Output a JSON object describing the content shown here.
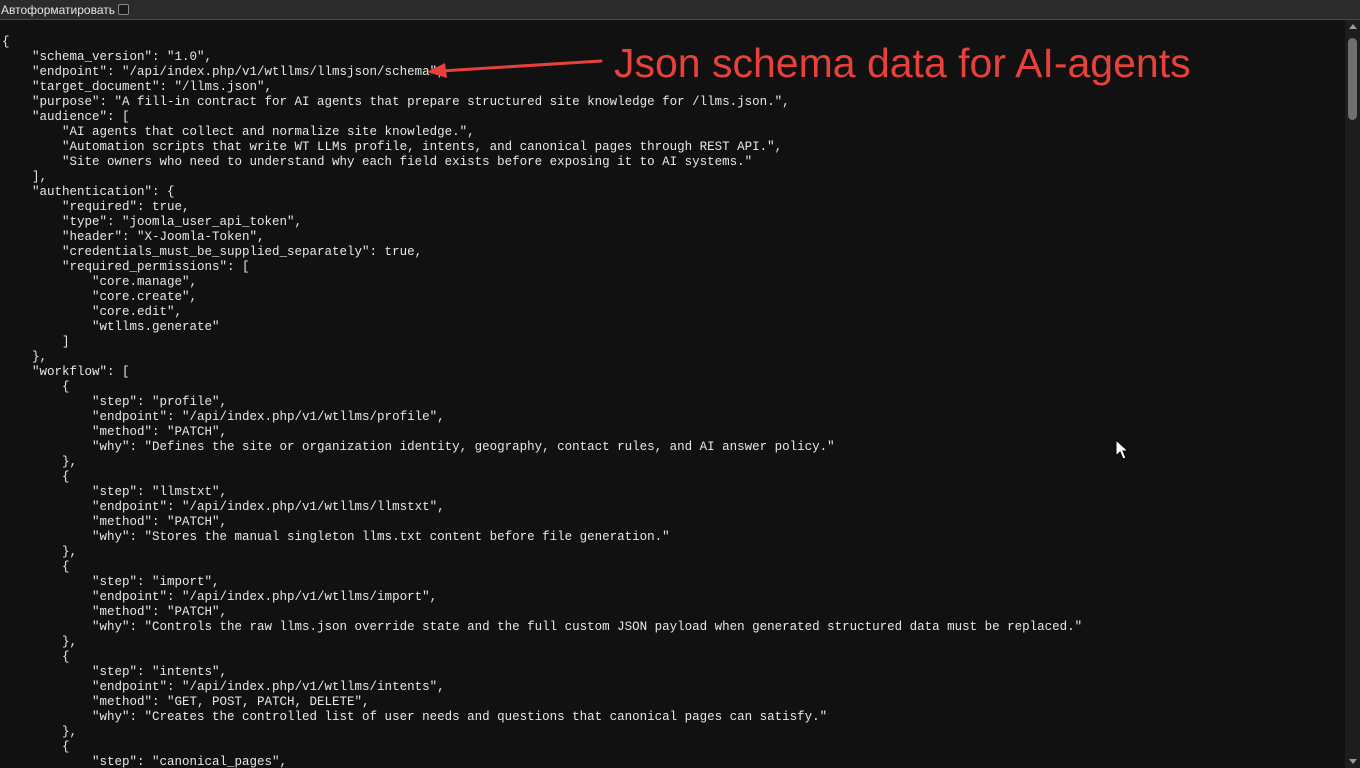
{
  "toolbar": {
    "autoformat_label": "Автоформатировать",
    "autoformat_checked": false
  },
  "annotation": {
    "text": "Json schema data for AI-agents",
    "color": "#e8403a"
  },
  "json_text": "{\n    \"schema_version\": \"1.0\",\n    \"endpoint\": \"/api/index.php/v1/wtllms/llmsjson/schema\",\n    \"target_document\": \"/llms.json\",\n    \"purpose\": \"A fill-in contract for AI agents that prepare structured site knowledge for /llms.json.\",\n    \"audience\": [\n        \"AI agents that collect and normalize site knowledge.\",\n        \"Automation scripts that write WT LLMs profile, intents, and canonical pages through REST API.\",\n        \"Site owners who need to understand why each field exists before exposing it to AI systems.\"\n    ],\n    \"authentication\": {\n        \"required\": true,\n        \"type\": \"joomla_user_api_token\",\n        \"header\": \"X-Joomla-Token\",\n        \"credentials_must_be_supplied_separately\": true,\n        \"required_permissions\": [\n            \"core.manage\",\n            \"core.create\",\n            \"core.edit\",\n            \"wtllms.generate\"\n        ]\n    },\n    \"workflow\": [\n        {\n            \"step\": \"profile\",\n            \"endpoint\": \"/api/index.php/v1/wtllms/profile\",\n            \"method\": \"PATCH\",\n            \"why\": \"Defines the site or organization identity, geography, contact rules, and AI answer policy.\"\n        },\n        {\n            \"step\": \"llmstxt\",\n            \"endpoint\": \"/api/index.php/v1/wtllms/llmstxt\",\n            \"method\": \"PATCH\",\n            \"why\": \"Stores the manual singleton llms.txt content before file generation.\"\n        },\n        {\n            \"step\": \"import\",\n            \"endpoint\": \"/api/index.php/v1/wtllms/import\",\n            \"method\": \"PATCH\",\n            \"why\": \"Controls the raw llms.json override state and the full custom JSON payload when generated structured data must be replaced.\"\n        },\n        {\n            \"step\": \"intents\",\n            \"endpoint\": \"/api/index.php/v1/wtllms/intents\",\n            \"method\": \"GET, POST, PATCH, DELETE\",\n            \"why\": \"Creates the controlled list of user needs and questions that canonical pages can satisfy.\"\n        },\n        {\n            \"step\": \"canonical_pages\","
}
